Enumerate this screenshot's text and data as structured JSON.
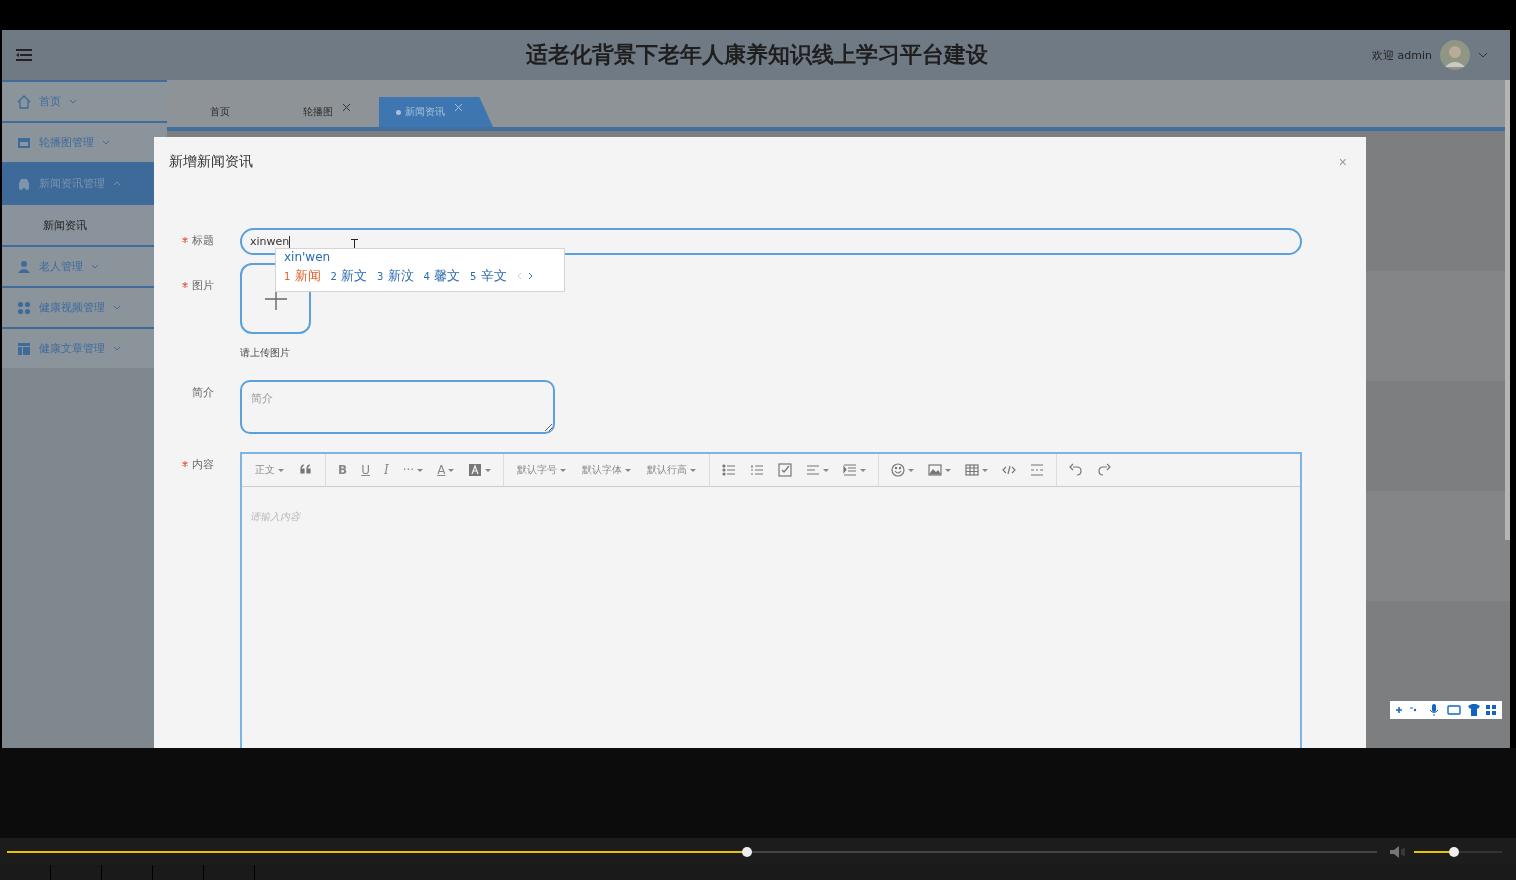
{
  "header": {
    "title": "适老化背景下老年人康养知识线上学习平台建设",
    "welcome": "欢迎 admin"
  },
  "sidebar": {
    "items": [
      {
        "label": "首页",
        "expanded": false,
        "selected": false
      },
      {
        "label": "轮播图管理",
        "expanded": false,
        "selected": false
      },
      {
        "label": "新闻资讯管理",
        "expanded": true,
        "selected": true,
        "children": [
          {
            "label": "新闻资讯",
            "selected": false
          }
        ]
      },
      {
        "label": "老人管理",
        "expanded": false,
        "selected": false
      },
      {
        "label": "健康视频管理",
        "expanded": false,
        "selected": false
      },
      {
        "label": "健康文章管理",
        "expanded": false,
        "selected": false
      }
    ]
  },
  "tabs": [
    {
      "label": "首页",
      "closable": false,
      "selected": false
    },
    {
      "label": "轮播图",
      "closable": true,
      "selected": false
    },
    {
      "label": "新闻资讯",
      "closable": true,
      "selected": true
    }
  ],
  "modal": {
    "title": "新增新闻资讯",
    "close": "×",
    "fields": [
      {
        "kind": "input",
        "label": "标题",
        "required": true,
        "value": "xinwen"
      },
      {
        "kind": "upload",
        "label": "图片",
        "required": true,
        "hint": "请上传图片"
      },
      {
        "kind": "textarea",
        "label": "简介",
        "required": false,
        "placeholder": "简介"
      },
      {
        "kind": "editor",
        "label": "内容",
        "required": true,
        "placeholder": "请输入内容"
      }
    ]
  },
  "editor_toolbar": [
    [
      {
        "kind": "text",
        "label": "正文",
        "dropdown": true
      },
      {
        "kind": "icon",
        "dropdown": false
      }
    ],
    [
      {
        "kind": "glyph",
        "label": "B",
        "dropdown": false
      },
      {
        "kind": "glyph",
        "label": "U",
        "dropdown": false
      },
      {
        "kind": "glyph",
        "label": "I",
        "dropdown": false
      },
      {
        "kind": "glyph",
        "label": "···",
        "dropdown": true
      },
      {
        "kind": "glyph",
        "label": "A",
        "dropdown": true
      },
      {
        "kind": "icon",
        "dropdown": true
      }
    ],
    [
      {
        "kind": "text",
        "label": "默认字号",
        "dropdown": true
      },
      {
        "kind": "text",
        "label": "默认字体",
        "dropdown": true
      },
      {
        "kind": "text",
        "label": "默认行高",
        "dropdown": true
      }
    ],
    [
      {
        "kind": "icon",
        "dropdown": false
      },
      {
        "kind": "icon",
        "dropdown": false
      },
      {
        "kind": "icon",
        "dropdown": false
      },
      {
        "kind": "icon",
        "dropdown": true
      },
      {
        "kind": "icon",
        "dropdown": true
      }
    ],
    [
      {
        "kind": "icon",
        "dropdown": true
      },
      {
        "kind": "icon",
        "dropdown": true
      },
      {
        "kind": "icon",
        "dropdown": true
      },
      {
        "kind": "icon",
        "dropdown": false
      },
      {
        "kind": "icon",
        "dropdown": false
      }
    ],
    [
      {
        "kind": "icon",
        "dropdown": false
      },
      {
        "kind": "icon",
        "dropdown": false
      }
    ]
  ],
  "ime": {
    "composition": "xin'wen",
    "candidates": [
      {
        "number": "1",
        "text": "新闻",
        "selected": true
      },
      {
        "number": "2",
        "text": "新文",
        "selected": false
      },
      {
        "number": "3",
        "text": "新汶",
        "selected": false
      },
      {
        "number": "4",
        "text": "馨文",
        "selected": false
      },
      {
        "number": "5",
        "text": "辛文",
        "selected": false
      }
    ]
  },
  "player": {
    "progress": {
      "level": 0.54
    },
    "volume": {
      "level": 0.45
    }
  }
}
